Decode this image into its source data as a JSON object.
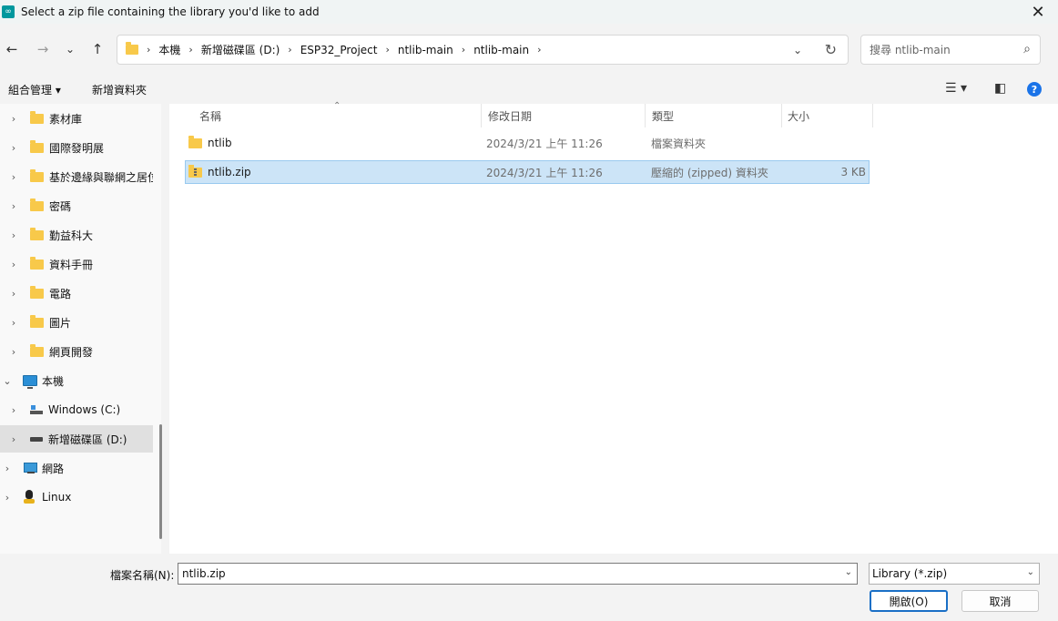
{
  "window": {
    "title": "Select a zip file containing the library you'd like to add",
    "close_glyph": "✕"
  },
  "nav": {
    "back_glyph": "←",
    "forward_glyph": "→",
    "recent_glyph": "⌄",
    "up_glyph": "↑",
    "breadcrumbs": [
      "本機",
      "新增磁碟區 (D:)",
      "ESP32_Project",
      "ntlib-main",
      "ntlib-main"
    ],
    "search_placeholder": "搜尋 ntlib-main"
  },
  "commandbar": {
    "organize": "組合管理 ▾",
    "new_folder": "新增資料夾"
  },
  "sidebar": {
    "items": [
      {
        "label": "素材庫",
        "icon": "folder-icon"
      },
      {
        "label": "國際發明展",
        "icon": "folder-icon"
      },
      {
        "label": "基於邊緣與聯網之居位",
        "icon": "folder-icon"
      },
      {
        "label": "密碼",
        "icon": "folder-icon"
      },
      {
        "label": "勤益科大",
        "icon": "folder-icon"
      },
      {
        "label": "資料手冊",
        "icon": "folder-icon"
      },
      {
        "label": "電路",
        "icon": "folder-icon"
      },
      {
        "label": "圖片",
        "icon": "folder-icon"
      },
      {
        "label": "網頁開發",
        "icon": "folder-icon"
      },
      {
        "label": "本機",
        "icon": "this-pc-icon"
      },
      {
        "label": "Windows (C:)",
        "icon": "windows-drive-icon"
      },
      {
        "label": "新增磁碟區 (D:)",
        "icon": "drive-icon"
      },
      {
        "label": "網路",
        "icon": "network-icon"
      },
      {
        "label": "Linux",
        "icon": "linux-icon"
      }
    ]
  },
  "files": {
    "columns": [
      "名稱",
      "修改日期",
      "類型",
      "大小"
    ],
    "rows": [
      {
        "name": "ntlib",
        "modified": "2024/3/21 上午 11:26",
        "type": "檔案資料夾",
        "size": ""
      },
      {
        "name": "ntlib.zip",
        "modified": "2024/3/21 上午 11:26",
        "type": "壓縮的 (zipped) 資料夾",
        "size": "3 KB"
      }
    ]
  },
  "footer": {
    "filename_label": "檔案名稱(N):",
    "filename_value": "ntlib.zip",
    "filetype": "Library (*.zip)",
    "open_button": "開啟(O)",
    "cancel_button": "取消"
  },
  "colors": {
    "selection": "#cce4f7",
    "accent": "#1a6fc6",
    "folder": "#f8c94a"
  }
}
